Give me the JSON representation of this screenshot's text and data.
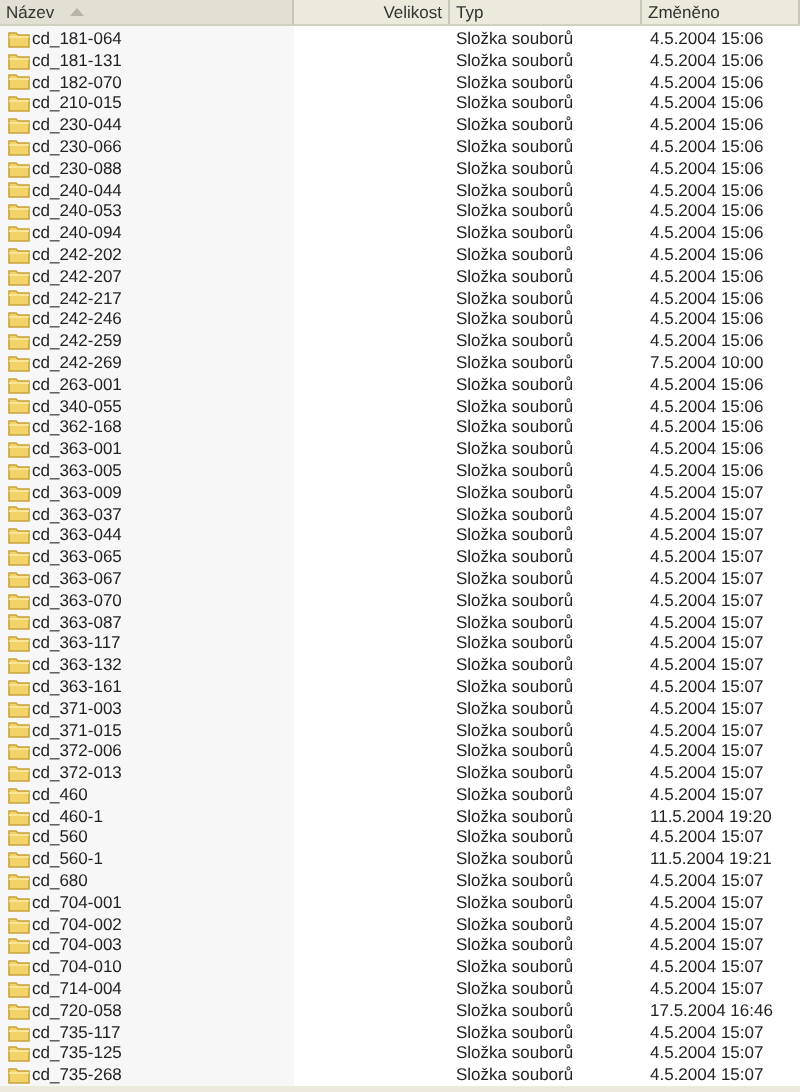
{
  "table": {
    "columns": [
      {
        "label": "Název",
        "sorted": true
      },
      {
        "label": "Velikost",
        "sorted": false
      },
      {
        "label": "Typ",
        "sorted": false
      },
      {
        "label": "Změněno",
        "sorted": false
      }
    ],
    "rows": [
      {
        "name": "cd_181-064",
        "type": "Složka souborů",
        "modified": "4.5.2004 15:06"
      },
      {
        "name": "cd_181-131",
        "type": "Složka souborů",
        "modified": "4.5.2004 15:06"
      },
      {
        "name": "cd_182-070",
        "type": "Složka souborů",
        "modified": "4.5.2004 15:06"
      },
      {
        "name": "cd_210-015",
        "type": "Složka souborů",
        "modified": "4.5.2004 15:06"
      },
      {
        "name": "cd_230-044",
        "type": "Složka souborů",
        "modified": "4.5.2004 15:06"
      },
      {
        "name": "cd_230-066",
        "type": "Složka souborů",
        "modified": "4.5.2004 15:06"
      },
      {
        "name": "cd_230-088",
        "type": "Složka souborů",
        "modified": "4.5.2004 15:06"
      },
      {
        "name": "cd_240-044",
        "type": "Složka souborů",
        "modified": "4.5.2004 15:06"
      },
      {
        "name": "cd_240-053",
        "type": "Složka souborů",
        "modified": "4.5.2004 15:06"
      },
      {
        "name": "cd_240-094",
        "type": "Složka souborů",
        "modified": "4.5.2004 15:06"
      },
      {
        "name": "cd_242-202",
        "type": "Složka souborů",
        "modified": "4.5.2004 15:06"
      },
      {
        "name": "cd_242-207",
        "type": "Složka souborů",
        "modified": "4.5.2004 15:06"
      },
      {
        "name": "cd_242-217",
        "type": "Složka souborů",
        "modified": "4.5.2004 15:06"
      },
      {
        "name": "cd_242-246",
        "type": "Složka souborů",
        "modified": "4.5.2004 15:06"
      },
      {
        "name": "cd_242-259",
        "type": "Složka souborů",
        "modified": "4.5.2004 15:06"
      },
      {
        "name": "cd_242-269",
        "type": "Složka souborů",
        "modified": "7.5.2004 10:00"
      },
      {
        "name": "cd_263-001",
        "type": "Složka souborů",
        "modified": "4.5.2004 15:06"
      },
      {
        "name": "cd_340-055",
        "type": "Složka souborů",
        "modified": "4.5.2004 15:06"
      },
      {
        "name": "cd_362-168",
        "type": "Složka souborů",
        "modified": "4.5.2004 15:06"
      },
      {
        "name": "cd_363-001",
        "type": "Složka souborů",
        "modified": "4.5.2004 15:06"
      },
      {
        "name": "cd_363-005",
        "type": "Složka souborů",
        "modified": "4.5.2004 15:06"
      },
      {
        "name": "cd_363-009",
        "type": "Složka souborů",
        "modified": "4.5.2004 15:07"
      },
      {
        "name": "cd_363-037",
        "type": "Složka souborů",
        "modified": "4.5.2004 15:07"
      },
      {
        "name": "cd_363-044",
        "type": "Složka souborů",
        "modified": "4.5.2004 15:07"
      },
      {
        "name": "cd_363-065",
        "type": "Složka souborů",
        "modified": "4.5.2004 15:07"
      },
      {
        "name": "cd_363-067",
        "type": "Složka souborů",
        "modified": "4.5.2004 15:07"
      },
      {
        "name": "cd_363-070",
        "type": "Složka souborů",
        "modified": "4.5.2004 15:07"
      },
      {
        "name": "cd_363-087",
        "type": "Složka souborů",
        "modified": "4.5.2004 15:07"
      },
      {
        "name": "cd_363-117",
        "type": "Složka souborů",
        "modified": "4.5.2004 15:07"
      },
      {
        "name": "cd_363-132",
        "type": "Složka souborů",
        "modified": "4.5.2004 15:07"
      },
      {
        "name": "cd_363-161",
        "type": "Složka souborů",
        "modified": "4.5.2004 15:07"
      },
      {
        "name": "cd_371-003",
        "type": "Složka souborů",
        "modified": "4.5.2004 15:07"
      },
      {
        "name": "cd_371-015",
        "type": "Složka souborů",
        "modified": "4.5.2004 15:07"
      },
      {
        "name": "cd_372-006",
        "type": "Složka souborů",
        "modified": "4.5.2004 15:07"
      },
      {
        "name": "cd_372-013",
        "type": "Složka souborů",
        "modified": "4.5.2004 15:07"
      },
      {
        "name": "cd_460",
        "type": "Složka souborů",
        "modified": "4.5.2004 15:07"
      },
      {
        "name": "cd_460-1",
        "type": "Složka souborů",
        "modified": "11.5.2004 19:20"
      },
      {
        "name": "cd_560",
        "type": "Složka souborů",
        "modified": "4.5.2004 15:07"
      },
      {
        "name": "cd_560-1",
        "type": "Složka souborů",
        "modified": "11.5.2004 19:21"
      },
      {
        "name": "cd_680",
        "type": "Složka souborů",
        "modified": "4.5.2004 15:07"
      },
      {
        "name": "cd_704-001",
        "type": "Složka souborů",
        "modified": "4.5.2004 15:07"
      },
      {
        "name": "cd_704-002",
        "type": "Složka souborů",
        "modified": "4.5.2004 15:07"
      },
      {
        "name": "cd_704-003",
        "type": "Složka souborů",
        "modified": "4.5.2004 15:07"
      },
      {
        "name": "cd_704-010",
        "type": "Složka souborů",
        "modified": "4.5.2004 15:07"
      },
      {
        "name": "cd_714-004",
        "type": "Složka souborů",
        "modified": "4.5.2004 15:07"
      },
      {
        "name": "cd_720-058",
        "type": "Složka souborů",
        "modified": "17.5.2004 16:46"
      },
      {
        "name": "cd_735-117",
        "type": "Složka souborů",
        "modified": "4.5.2004 15:07"
      },
      {
        "name": "cd_735-125",
        "type": "Složka souborů",
        "modified": "4.5.2004 15:07"
      },
      {
        "name": "cd_735-268",
        "type": "Složka souborů",
        "modified": "4.5.2004 15:07"
      }
    ]
  }
}
